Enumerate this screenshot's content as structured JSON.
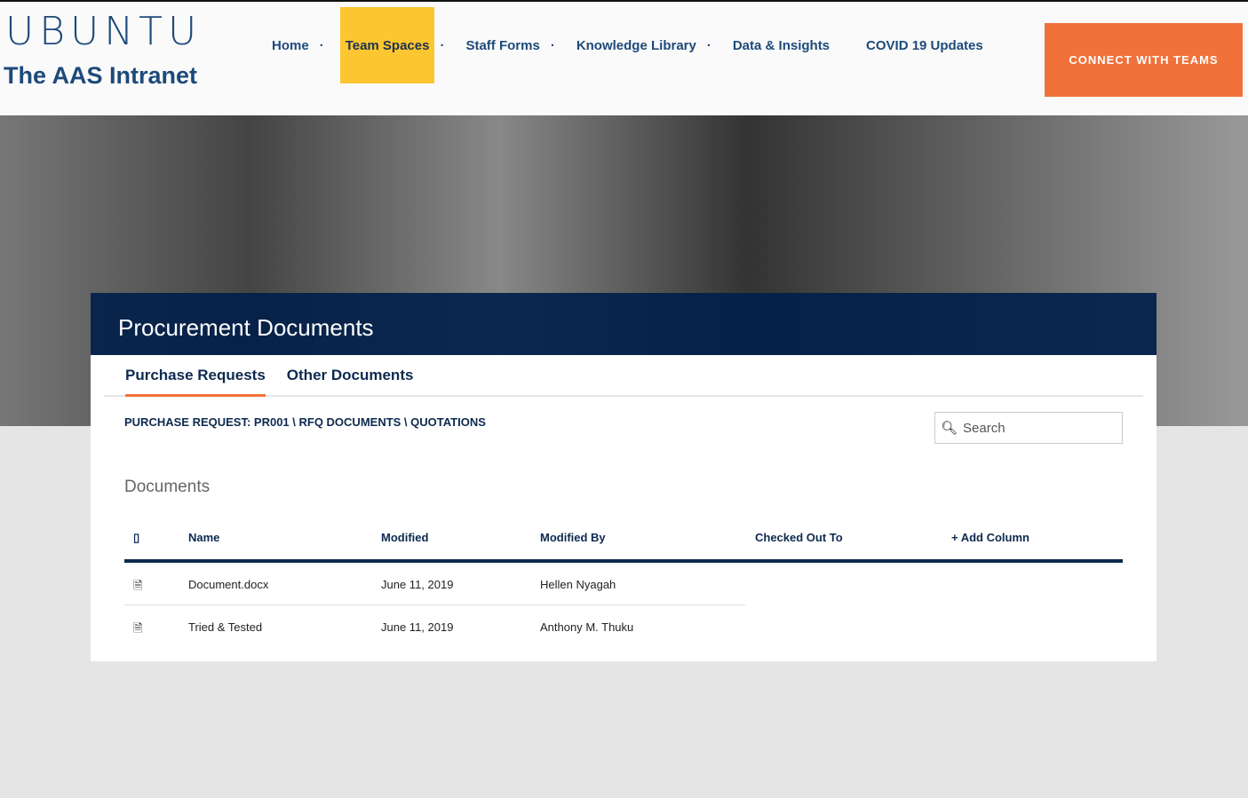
{
  "header": {
    "logo": "UBUNTU",
    "subtitle": "The AAS Intranet",
    "nav": [
      "Home",
      "Team Spaces",
      "Staff Forms",
      "Knowledge Library",
      "Data & Insights",
      "COVID 19 Updates"
    ],
    "cta": "CONNECT WITH TEAMS"
  },
  "page": {
    "title": "Procurement Documents",
    "tabs": [
      "Purchase Requests",
      "Other Documents"
    ],
    "breadcrumb": "PURCHASE REQUEST: PR001 \\ RFQ DOCUMENTS \\ QUOTATIONS",
    "search_placeholder": "Search",
    "section": "Documents"
  },
  "table": {
    "columns": [
      "Name",
      "Modified",
      "Modified By",
      "Checked Out To",
      "+ Add Column"
    ],
    "rows": [
      {
        "name": "Document.docx",
        "modified": "June 11, 2019",
        "by": "Hellen Nyagah",
        "icon": "word-file-icon"
      },
      {
        "name": "Tried & Tested",
        "modified": "June 11, 2019",
        "by": "Anthony M. Thuku",
        "icon": "excel-file-icon"
      }
    ]
  }
}
